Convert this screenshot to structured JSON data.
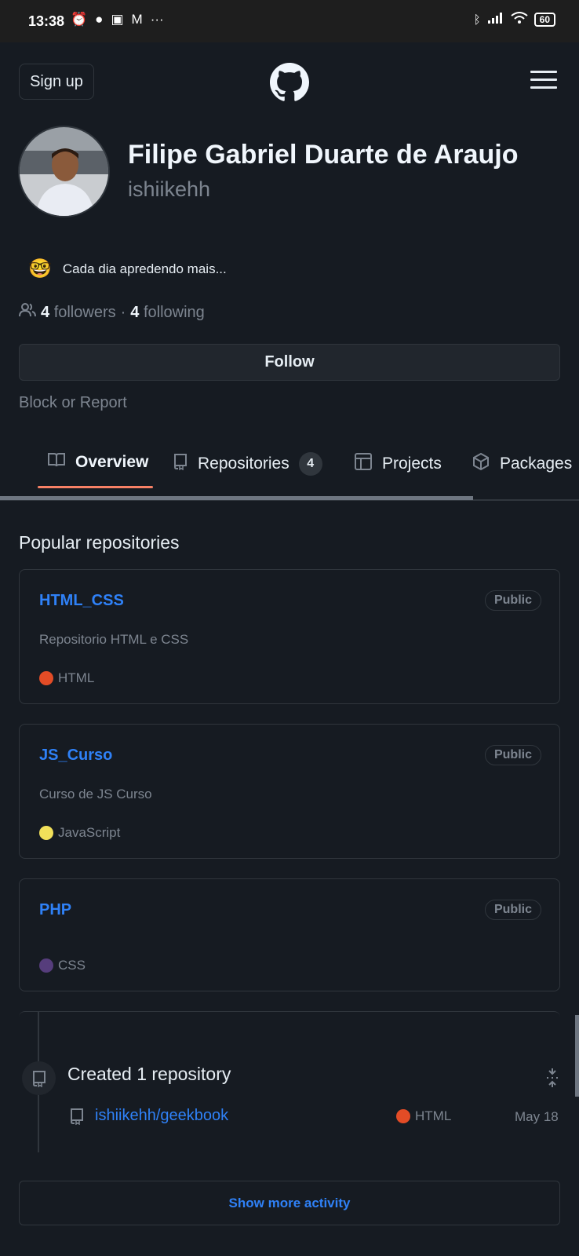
{
  "status_bar": {
    "time": "13:38",
    "battery": "60",
    "left_icons": [
      "alarm-icon",
      "reddit-icon",
      "app-icon",
      "gmail-icon",
      "more-dots-icon"
    ],
    "right_icons": [
      "bluetooth-icon",
      "signal-icon",
      "wifi-icon",
      "battery-icon"
    ]
  },
  "header": {
    "signup_label": "Sign up",
    "logo": "github-logo-icon",
    "menu": "hamburger-menu-icon"
  },
  "profile": {
    "full_name": "Filipe Gabriel Duarte de Araujo",
    "username": "ishiikehh",
    "status_emoji": "🤓",
    "status_text": "Cada dia apredendo mais...",
    "followers_count": "4",
    "followers_label": "followers",
    "separator": "·",
    "following_count": "4",
    "following_label": "following",
    "follow_button": "Follow",
    "block_report": "Block or Report"
  },
  "tabs": [
    {
      "label": "Overview",
      "icon": "book-icon",
      "active": true
    },
    {
      "label": "Repositories",
      "icon": "repo-icon",
      "counter": "4"
    },
    {
      "label": "Projects",
      "icon": "table-icon"
    },
    {
      "label": "Packages",
      "icon": "package-icon"
    }
  ],
  "popular": {
    "title": "Popular repositories",
    "repos": [
      {
        "name": "HTML_CSS",
        "visibility": "Public",
        "description": "Repositorio HTML e CSS",
        "language": "HTML",
        "language_color": "#e34c26"
      },
      {
        "name": "JS_Curso",
        "visibility": "Public",
        "description": "Curso de JS Curso",
        "language": "JavaScript",
        "language_color": "#f1e05a"
      },
      {
        "name": "PHP",
        "visibility": "Public",
        "description": "",
        "language": "CSS",
        "language_color": "#563d7c"
      }
    ]
  },
  "activity": {
    "title": "Created 1 repository",
    "repo": "ishiikehh/geekbook",
    "language": "HTML",
    "language_color": "#e34c26",
    "date": "May 18",
    "show_more": "Show more activity"
  },
  "colors": {
    "background": "#161b22",
    "link": "#2f81f7",
    "muted": "#7d8590",
    "border": "#30363d",
    "tab_underline": "#f78166"
  }
}
